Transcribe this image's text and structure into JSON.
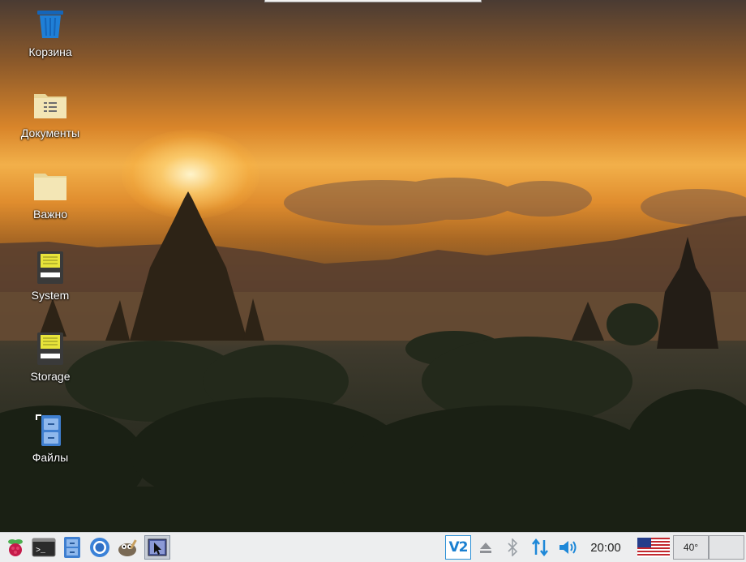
{
  "desktop": {
    "icons": [
      {
        "label": "Корзина",
        "icon": "trash-icon"
      },
      {
        "label": "Документы",
        "icon": "documents-folder-icon"
      },
      {
        "label": "Важно",
        "icon": "folder-icon"
      },
      {
        "label": "System",
        "icon": "drive-icon"
      },
      {
        "label": "Storage",
        "icon": "drive-icon"
      },
      {
        "label": "Файлы",
        "icon": "file-manager-icon"
      }
    ]
  },
  "taskbar": {
    "launchers": [
      {
        "icon": "raspberry-menu-icon"
      },
      {
        "icon": "terminal-icon"
      },
      {
        "icon": "file-cabinet-icon"
      },
      {
        "icon": "chromium-browser-icon"
      },
      {
        "icon": "gimp-icon"
      },
      {
        "icon": "screenshot-tool-icon"
      }
    ],
    "tray": {
      "vnc_label": "V2",
      "clock": "20:00",
      "keyboard_layout": "us-flag-icon",
      "cpu_temp": "40°"
    }
  },
  "colors": {
    "taskbar_bg": "#edeeef",
    "trash_blue": "#1f7fd6",
    "folder_beige": "#f1e2a8"
  }
}
